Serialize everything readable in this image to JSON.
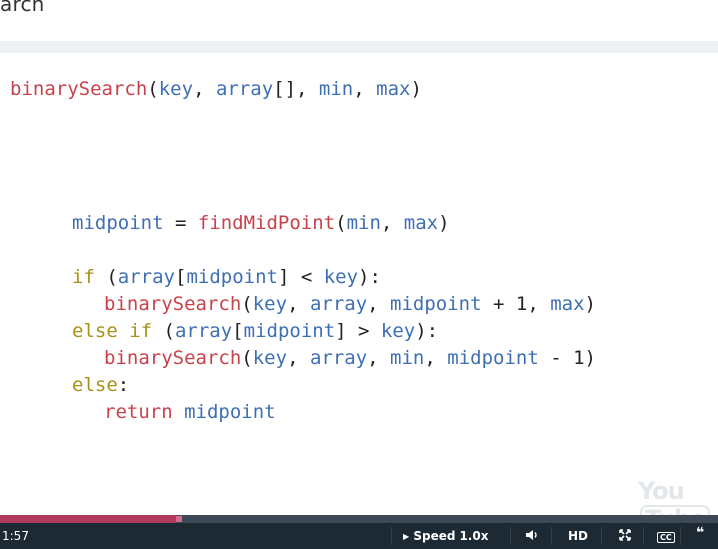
{
  "page": {
    "title": "arch"
  },
  "code": {
    "lines": [
      [
        {
          "c": "fn",
          "t": "binarySearch"
        },
        {
          "c": "p",
          "t": "("
        },
        {
          "c": "id",
          "t": "key"
        },
        {
          "c": "p",
          "t": ", "
        },
        {
          "c": "id",
          "t": "array"
        },
        {
          "c": "p",
          "t": "[], "
        },
        {
          "c": "id",
          "t": "min"
        },
        {
          "c": "p",
          "t": ", "
        },
        {
          "c": "id",
          "t": "max"
        },
        {
          "c": "p",
          "t": ")"
        }
      ],
      [
        {
          "c": "id",
          "t": "midpoint"
        },
        {
          "c": "p",
          "t": " = "
        },
        {
          "c": "fn",
          "t": "findMidPoint"
        },
        {
          "c": "p",
          "t": "("
        },
        {
          "c": "id",
          "t": "min"
        },
        {
          "c": "p",
          "t": ", "
        },
        {
          "c": "id",
          "t": "max"
        },
        {
          "c": "p",
          "t": ")"
        }
      ],
      [
        {
          "c": "kw",
          "t": "if"
        },
        {
          "c": "p",
          "t": " ("
        },
        {
          "c": "id",
          "t": "array"
        },
        {
          "c": "p",
          "t": "["
        },
        {
          "c": "id",
          "t": "midpoint"
        },
        {
          "c": "p",
          "t": "] < "
        },
        {
          "c": "id",
          "t": "key"
        },
        {
          "c": "p",
          "t": "):"
        }
      ],
      [
        {
          "c": "fn",
          "t": "binarySearch"
        },
        {
          "c": "p",
          "t": "("
        },
        {
          "c": "id",
          "t": "key"
        },
        {
          "c": "p",
          "t": ", "
        },
        {
          "c": "id",
          "t": "array"
        },
        {
          "c": "p",
          "t": ", "
        },
        {
          "c": "id",
          "t": "midpoint"
        },
        {
          "c": "p",
          "t": " + 1, "
        },
        {
          "c": "id",
          "t": "max"
        },
        {
          "c": "p",
          "t": ")"
        }
      ],
      [
        {
          "c": "kw",
          "t": "else if"
        },
        {
          "c": "p",
          "t": " ("
        },
        {
          "c": "id",
          "t": "array"
        },
        {
          "c": "p",
          "t": "["
        },
        {
          "c": "id",
          "t": "midpoint"
        },
        {
          "c": "p",
          "t": "] > "
        },
        {
          "c": "id",
          "t": "key"
        },
        {
          "c": "p",
          "t": "):"
        }
      ],
      [
        {
          "c": "fn",
          "t": "binarySearch"
        },
        {
          "c": "p",
          "t": "("
        },
        {
          "c": "id",
          "t": "key"
        },
        {
          "c": "p",
          "t": ", "
        },
        {
          "c": "id",
          "t": "array"
        },
        {
          "c": "p",
          "t": ", "
        },
        {
          "c": "id",
          "t": "min"
        },
        {
          "c": "p",
          "t": ", "
        },
        {
          "c": "id",
          "t": "midpoint"
        },
        {
          "c": "p",
          "t": " - 1)"
        }
      ],
      [
        {
          "c": "kw",
          "t": "else"
        },
        {
          "c": "p",
          "t": ":"
        }
      ],
      [
        {
          "c": "fn",
          "t": "return"
        },
        {
          "c": "p",
          "t": " "
        },
        {
          "c": "id",
          "t": "midpoint"
        }
      ]
    ]
  },
  "player": {
    "time": "1:57",
    "progress_percent": 24.5,
    "speed_label": "Speed",
    "speed_value": "1.0x",
    "volume_icon": "volume-icon",
    "hd_label": "HD",
    "fullscreen_icon": "fullscreen-icon",
    "cc_label": "CC",
    "transcript_icon": "quote-icon",
    "logo_you": "You",
    "logo_tube": "Tube"
  },
  "colors": {
    "function": "#c8424b",
    "identifier": "#3e6fb4",
    "keyword": "#a8911a",
    "progress_fill": "#b03a5e",
    "control_bar": "#1d2a33"
  }
}
